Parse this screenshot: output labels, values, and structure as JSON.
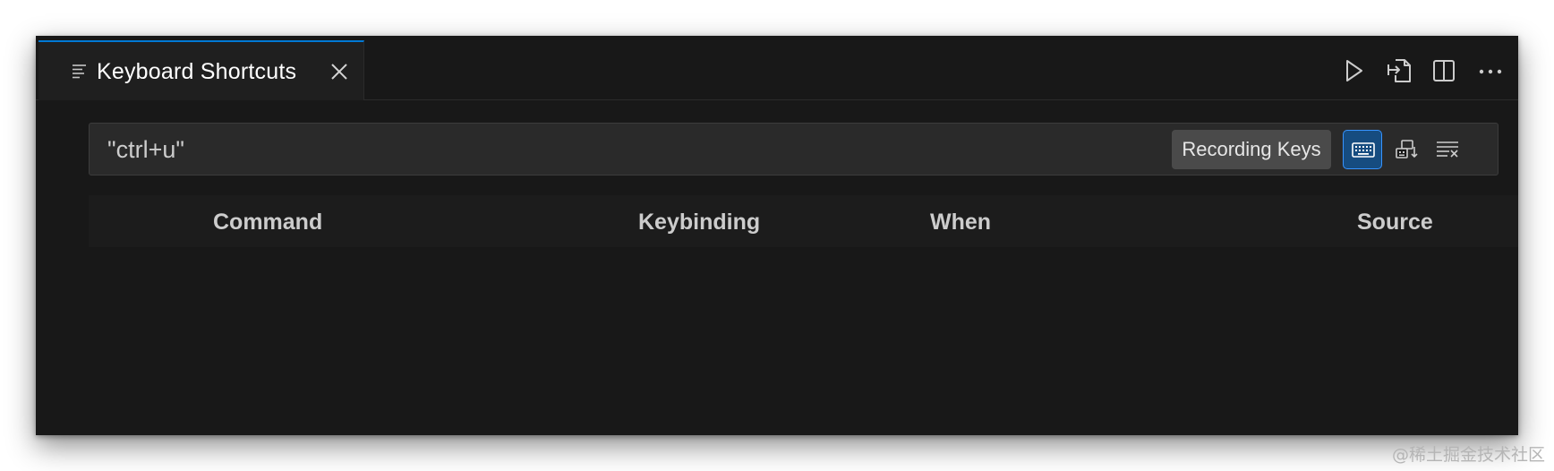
{
  "tab": {
    "label": "Keyboard Shortcuts",
    "icon": "preview-lines-icon",
    "close_icon": "close-icon"
  },
  "editor_actions": [
    {
      "name": "run",
      "icon": "play-icon"
    },
    {
      "name": "open-json",
      "icon": "open-file-icon"
    },
    {
      "name": "split-editor",
      "icon": "split-editor-icon"
    },
    {
      "name": "more",
      "icon": "more-icon"
    }
  ],
  "search": {
    "value": "\"ctrl+u\"",
    "recording_badge": "Recording Keys",
    "buttons": [
      {
        "name": "record-keys",
        "icon": "keyboard-icon",
        "active": true
      },
      {
        "name": "sort-by-precedence",
        "icon": "sort-precedence-icon",
        "active": false
      },
      {
        "name": "clear-search",
        "icon": "clear-all-icon",
        "active": false
      }
    ]
  },
  "table": {
    "columns": [
      "Command",
      "Keybinding",
      "When",
      "Source"
    ]
  },
  "colors": {
    "editor_background": "#181818",
    "tab_active_border": "#0078d4",
    "toggle_active_background": "#164c80",
    "toggle_active_border": "#3794ff",
    "text": "#cccccc"
  },
  "watermark": "@稀土掘金技术社区"
}
